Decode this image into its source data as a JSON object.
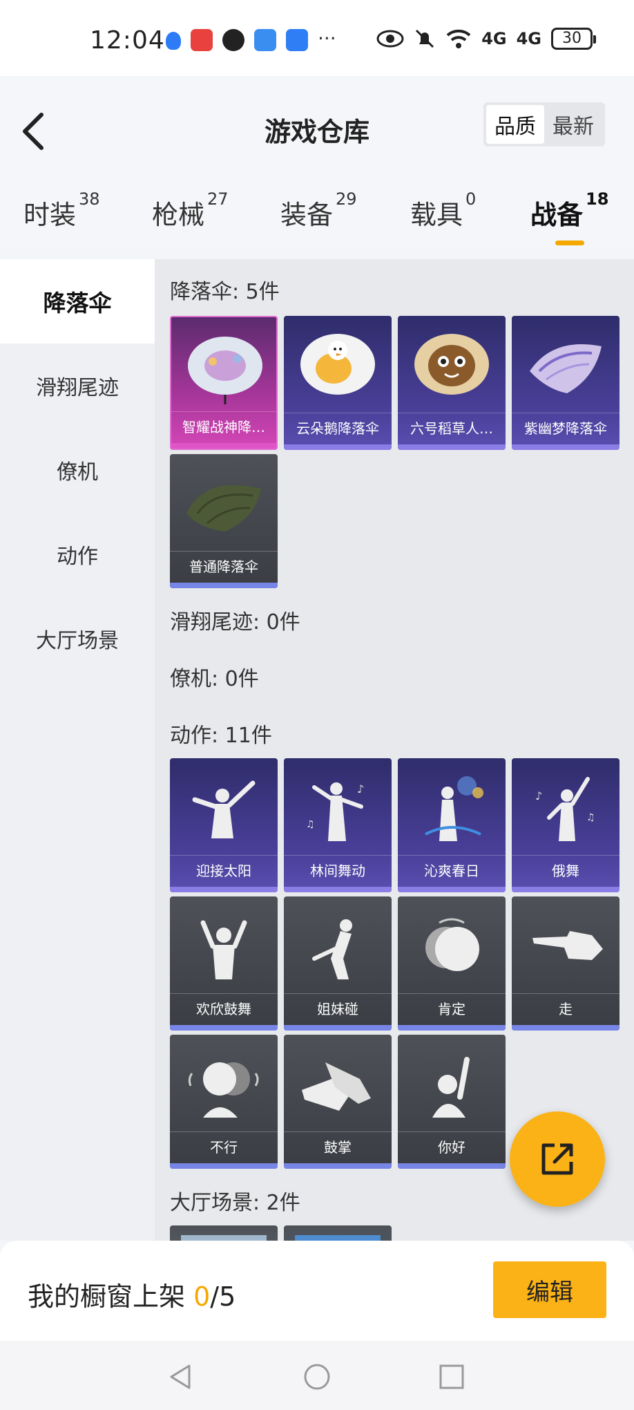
{
  "status_bar": {
    "time": "12:04",
    "battery": "30",
    "signal1": "4G",
    "signal2": "4G"
  },
  "header": {
    "title": "游戏仓库",
    "sort_options": [
      "品质",
      "最新"
    ],
    "sort_selected": "品质"
  },
  "tabs": [
    {
      "label": "时装",
      "count": "38"
    },
    {
      "label": "枪械",
      "count": "27"
    },
    {
      "label": "装备",
      "count": "29"
    },
    {
      "label": "载具",
      "count": "0"
    },
    {
      "label": "战备",
      "count": "18"
    }
  ],
  "sidebar": [
    "降落伞",
    "滑翔尾迹",
    "僚机",
    "动作",
    "大厅场景"
  ],
  "sections": {
    "parachute": {
      "title": "降落伞: 5件",
      "items": [
        "智耀战神降…",
        "云朵鹅降落伞",
        "六号稻草人…",
        "紫幽梦降落伞",
        "普通降落伞"
      ]
    },
    "trail": {
      "title": "滑翔尾迹: 0件"
    },
    "wingman": {
      "title": "僚机: 0件"
    },
    "emotes": {
      "title": "动作: 11件",
      "items": [
        "迎接太阳",
        "林间舞动",
        "沁爽春日",
        "俄舞",
        "欢欣鼓舞",
        "姐妹碰",
        "肯定",
        "走",
        "不行",
        "鼓掌",
        "你好"
      ]
    },
    "lobby": {
      "title": "大厅场景: 2件"
    }
  },
  "bottom": {
    "label": "我的橱窗上架 ",
    "current": "0",
    "total": "/5",
    "edit": "编辑"
  },
  "colors": {
    "accent": "#fbb216",
    "purple_card": "#4a3f99",
    "pink_card": "#d447b7",
    "gray_card": "#4e5157"
  }
}
